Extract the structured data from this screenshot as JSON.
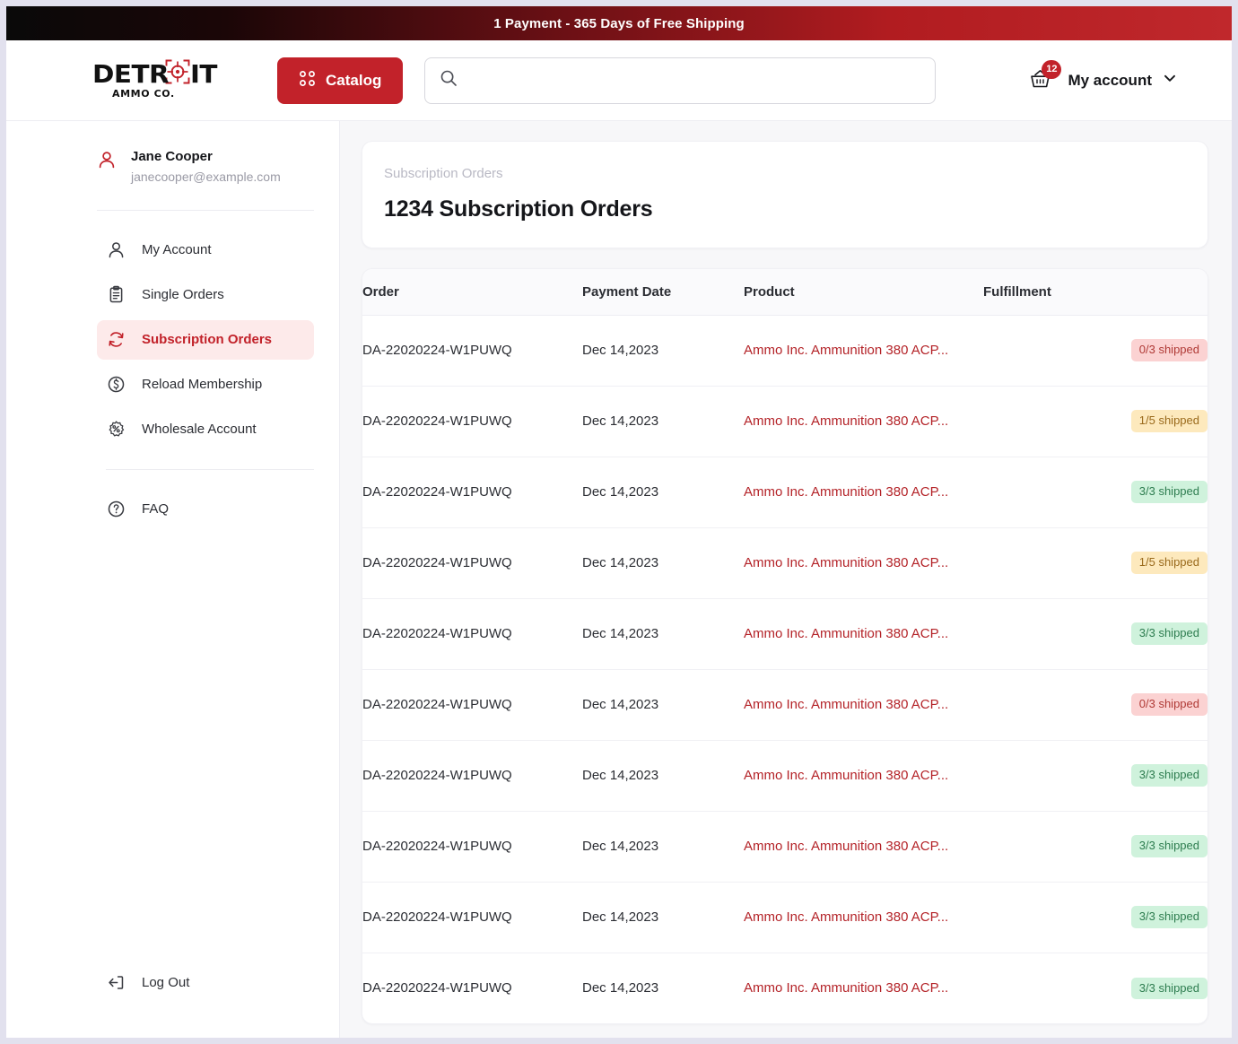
{
  "promo": {
    "text": "1 Payment - 365 Days of Free Shipping",
    "gradient_from": "#090909",
    "gradient_to": "#c0282c"
  },
  "header": {
    "logo": {
      "word_left": "DETR",
      "word_right": "IT",
      "subtitle": "AMMO CO.",
      "target_icon": "crosshair-target-icon"
    },
    "catalog_button": {
      "label": "Catalog",
      "icon": "grid-dots-icon",
      "color": "#c2222a"
    },
    "search": {
      "value": "",
      "placeholder": "",
      "icon": "search-icon"
    },
    "cart": {
      "icon": "shopping-basket-icon",
      "badge_count": "12",
      "badge_color": "#c2222a"
    },
    "account": {
      "label": "My account",
      "icon": "chevron-down-icon"
    }
  },
  "sidebar": {
    "profile": {
      "name": "Jane Cooper",
      "email": "janecooper@example.com",
      "icon": "user-icon",
      "icon_color": "#c2222a"
    },
    "items": [
      {
        "label": "My Account",
        "icon": "user-icon",
        "active": false
      },
      {
        "label": "Single Orders",
        "icon": "clipboard-icon",
        "active": false
      },
      {
        "label": "Subscription Orders",
        "icon": "refresh-cycle-icon",
        "active": true
      },
      {
        "label": "Reload Membership",
        "icon": "dollar-circle-icon",
        "active": false
      },
      {
        "label": "Wholesale Account",
        "icon": "percent-badge-icon",
        "active": false
      }
    ],
    "secondary_items": [
      {
        "label": "FAQ",
        "icon": "question-circle-icon",
        "active": false
      }
    ],
    "logout": {
      "label": "Log Out",
      "icon": "logout-icon"
    },
    "active_bg": "#fdeaea",
    "active_color": "#c2222a"
  },
  "main": {
    "title_card": {
      "eyebrow": "Subscription Orders",
      "headline": "1234 Subscription Orders"
    },
    "table": {
      "columns": [
        "Order",
        "Payment Date",
        "Product",
        "Fulfillment"
      ],
      "rows": [
        {
          "order": "DA-22020224-W1PUWQ",
          "date": "Dec 14,2023",
          "product": "Ammo Inc. Ammunition 380 ACP...",
          "fulfillment": "0/3 shipped",
          "status": "red"
        },
        {
          "order": "DA-22020224-W1PUWQ",
          "date": "Dec 14,2023",
          "product": "Ammo Inc. Ammunition 380 ACP...",
          "fulfillment": "1/5 shipped",
          "status": "amber"
        },
        {
          "order": "DA-22020224-W1PUWQ",
          "date": "Dec 14,2023",
          "product": "Ammo Inc. Ammunition 380 ACP...",
          "fulfillment": "3/3 shipped",
          "status": "green"
        },
        {
          "order": "DA-22020224-W1PUWQ",
          "date": "Dec 14,2023",
          "product": "Ammo Inc. Ammunition 380 ACP...",
          "fulfillment": "1/5 shipped",
          "status": "amber"
        },
        {
          "order": "DA-22020224-W1PUWQ",
          "date": "Dec 14,2023",
          "product": "Ammo Inc. Ammunition 380 ACP...",
          "fulfillment": "3/3 shipped",
          "status": "green"
        },
        {
          "order": "DA-22020224-W1PUWQ",
          "date": "Dec 14,2023",
          "product": "Ammo Inc. Ammunition 380 ACP...",
          "fulfillment": "0/3 shipped",
          "status": "red"
        },
        {
          "order": "DA-22020224-W1PUWQ",
          "date": "Dec 14,2023",
          "product": "Ammo Inc. Ammunition 380 ACP...",
          "fulfillment": "3/3 shipped",
          "status": "green"
        },
        {
          "order": "DA-22020224-W1PUWQ",
          "date": "Dec 14,2023",
          "product": "Ammo Inc. Ammunition 380 ACP...",
          "fulfillment": "3/3 shipped",
          "status": "green"
        },
        {
          "order": "DA-22020224-W1PUWQ",
          "date": "Dec 14,2023",
          "product": "Ammo Inc. Ammunition 380 ACP...",
          "fulfillment": "3/3 shipped",
          "status": "green"
        },
        {
          "order": "DA-22020224-W1PUWQ",
          "date": "Dec 14,2023",
          "product": "Ammo Inc. Ammunition 380 ACP...",
          "fulfillment": "3/3 shipped",
          "status": "green"
        }
      ]
    }
  },
  "colors": {
    "brand_red": "#c2222a",
    "link_red": "#b42328",
    "page_bg": "#f7f7f9",
    "status_red_bg": "#fbd2d2",
    "status_amber_bg": "#fde9bd",
    "status_green_bg": "#cff2dc"
  }
}
